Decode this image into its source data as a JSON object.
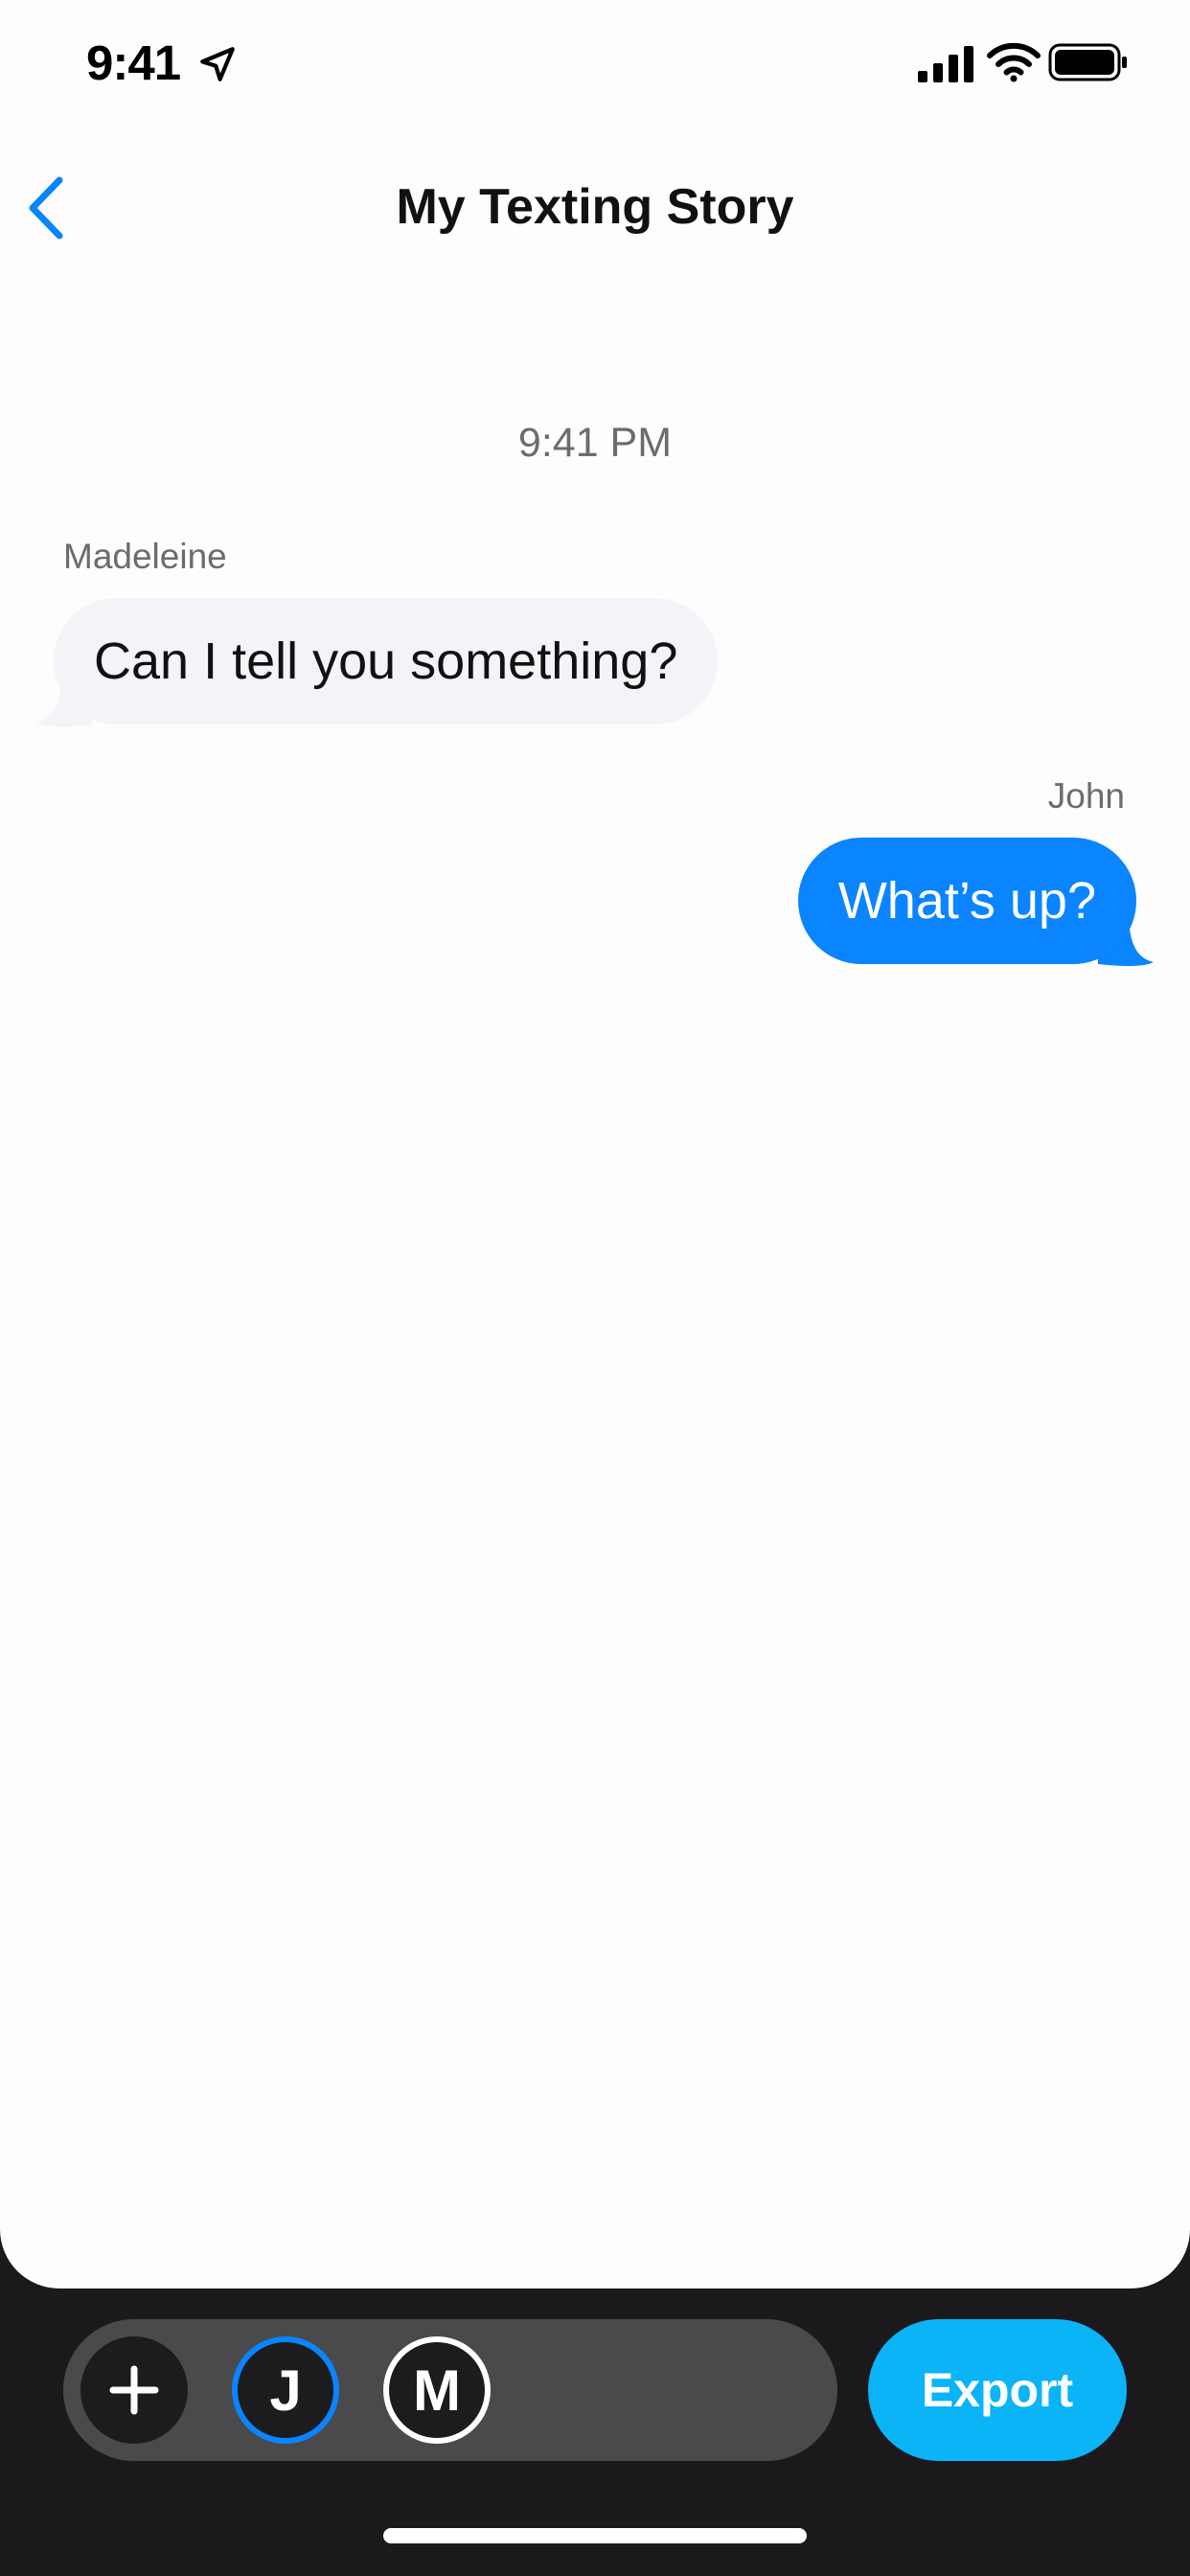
{
  "status_bar": {
    "time": "9:41"
  },
  "nav": {
    "title": "My Texting Story"
  },
  "chat": {
    "timestamp": "9:41 PM",
    "messages": [
      {
        "sender": "Madeleine",
        "text": "Can I tell you something?",
        "side": "left"
      },
      {
        "sender": "John",
        "text": "What’s up?",
        "side": "right"
      }
    ]
  },
  "toolbar": {
    "participants": [
      {
        "initial": "J",
        "selected": true
      },
      {
        "initial": "M",
        "selected": false
      }
    ],
    "export_label": "Export"
  },
  "colors": {
    "accent": "#0a84ff",
    "export": "#0bb4f7",
    "incoming_bubble": "#f3f3f8",
    "toolbar_bg": "#1c191d"
  }
}
